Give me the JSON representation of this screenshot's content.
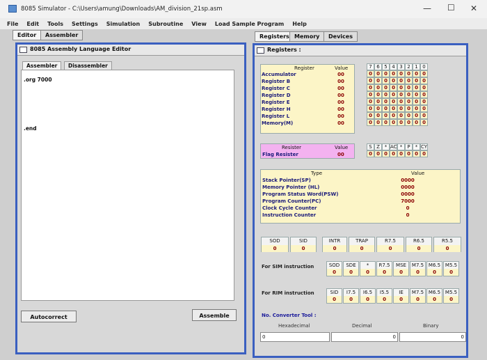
{
  "window": {
    "title": "8085 Simulator - C:\\Users\\amung\\Downloads\\AM_division_21sp.asm"
  },
  "menu": [
    "File",
    "Edit",
    "Tools",
    "Settings",
    "Simulation",
    "Subroutine",
    "View",
    "Load Sample Program",
    "Help"
  ],
  "left_tabs": {
    "editor": "Editor",
    "assembler": "Assembler"
  },
  "right_tabs": {
    "registers": "Registers",
    "memory": "Memory",
    "devices": "Devices"
  },
  "editor": {
    "panel_title": "8085 Assembly Language Editor",
    "tab_assembler": "Assembler",
    "tab_disassembler": "Disassembler",
    "line1": ".org 7000",
    "line2": ".end",
    "autocorrect": "Autocorrect",
    "assemble": "Assemble"
  },
  "registers": {
    "panel_title": "Registers :",
    "col_register": "Register",
    "col_value": "Value",
    "bit_headers": [
      "7",
      "6",
      "5",
      "4",
      "3",
      "2",
      "1",
      "0"
    ],
    "rows": [
      {
        "name": "Accumulator",
        "value": "00",
        "bits": [
          "0",
          "0",
          "0",
          "0",
          "0",
          "0",
          "0",
          "0"
        ]
      },
      {
        "name": "Register B",
        "value": "00",
        "bits": [
          "0",
          "0",
          "0",
          "0",
          "0",
          "0",
          "0",
          "0"
        ]
      },
      {
        "name": "Register C",
        "value": "00",
        "bits": [
          "0",
          "0",
          "0",
          "0",
          "0",
          "0",
          "0",
          "0"
        ]
      },
      {
        "name": "Register D",
        "value": "00",
        "bits": [
          "0",
          "0",
          "0",
          "0",
          "0",
          "0",
          "0",
          "0"
        ]
      },
      {
        "name": "Register E",
        "value": "00",
        "bits": [
          "0",
          "0",
          "0",
          "0",
          "0",
          "0",
          "0",
          "0"
        ]
      },
      {
        "name": "Register H",
        "value": "00",
        "bits": [
          "0",
          "0",
          "0",
          "0",
          "0",
          "0",
          "0",
          "0"
        ]
      },
      {
        "name": "Register L",
        "value": "00",
        "bits": [
          "0",
          "0",
          "0",
          "0",
          "0",
          "0",
          "0",
          "0"
        ]
      },
      {
        "name": "Memory(M)",
        "value": "00",
        "bits": [
          "0",
          "0",
          "0",
          "0",
          "0",
          "0",
          "0",
          "0"
        ]
      }
    ],
    "flag": {
      "col_register": "Resister",
      "col_value": "Value",
      "name": "Flag Resister",
      "value": "00",
      "headers": [
        "S",
        "Z",
        "*",
        "AC",
        "*",
        "P",
        "*",
        "CY"
      ],
      "bits": [
        "0",
        "0",
        "0",
        "0",
        "0",
        "0",
        "0",
        "0"
      ]
    },
    "special": {
      "col_type": "Type",
      "col_value": "Value",
      "rows": [
        {
          "name": "Stack Pointer(SP)",
          "value": "0000"
        },
        {
          "name": "Memory Pointer (HL)",
          "value": "0000"
        },
        {
          "name": "Program Status Word(PSW)",
          "value": "0000"
        },
        {
          "name": "Program Counter(PC)",
          "value": "7000"
        },
        {
          "name": "Clock Cycle Counter",
          "value": "0"
        },
        {
          "name": "Instruction Counter",
          "value": "0"
        }
      ]
    },
    "interrupts": [
      {
        "label": "SOD",
        "value": "0"
      },
      {
        "label": "SID",
        "value": "0"
      },
      {
        "label": "INTR",
        "value": "0"
      },
      {
        "label": "TRAP",
        "value": "0"
      },
      {
        "label": "R7.5",
        "value": "0"
      },
      {
        "label": "R6.5",
        "value": "0"
      },
      {
        "label": "R5.5",
        "value": "0"
      }
    ],
    "sim": {
      "label": "For SIM instruction",
      "headers": [
        "SOD",
        "SDE",
        "*",
        "R7.5",
        "MSE",
        "M7.5",
        "M6.5",
        "M5.5"
      ],
      "values": [
        "0",
        "0",
        "0",
        "0",
        "0",
        "0",
        "0",
        "0"
      ]
    },
    "rim": {
      "label": "For RIM instruction",
      "headers": [
        "SID",
        "I7.5",
        "I6.5",
        "I5.5",
        "IE",
        "M7.5",
        "M6.5",
        "M5.5"
      ],
      "values": [
        "0",
        "0",
        "0",
        "0",
        "0",
        "0",
        "0",
        "0"
      ]
    },
    "converter": {
      "title": "No. Converter Tool :",
      "hex_label": "Hexadecimal",
      "dec_label": "Decimal",
      "bin_label": "Binary",
      "hex": "0",
      "dec": "0",
      "bin": "0"
    }
  }
}
